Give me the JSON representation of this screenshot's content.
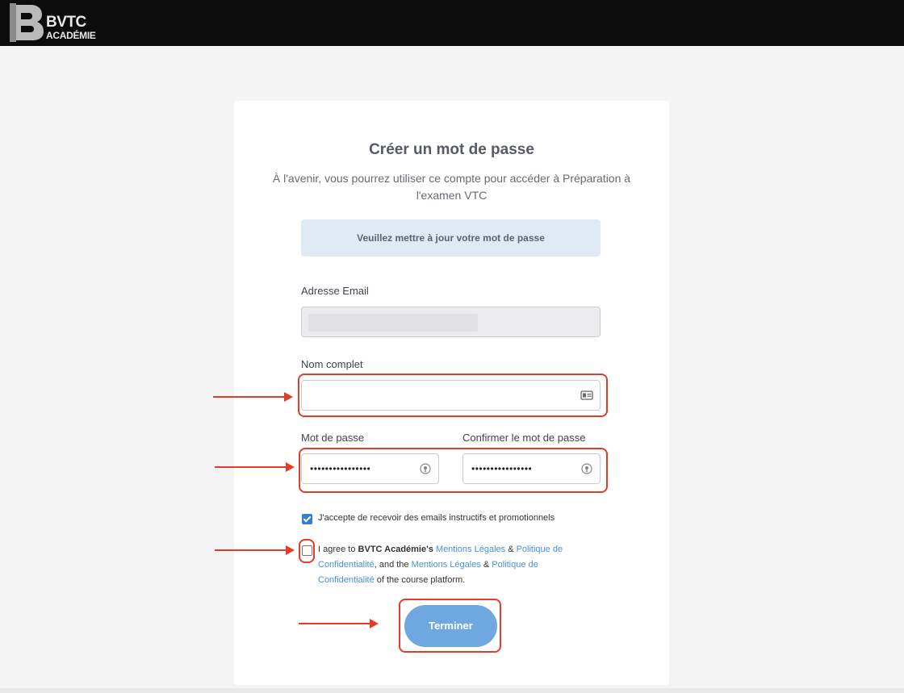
{
  "header": {
    "brand_line1": "BVTC",
    "brand_line2": "ACADÉMIE",
    "logo_icon": "bvtc-b-logo-icon"
  },
  "card": {
    "title": "Créer un mot de passe",
    "subtitle": "À l'avenir, vous pourrez utiliser ce compte pour accéder à Préparation à l'examen VTC",
    "notice": "Veuillez mettre à jour votre mot de passe"
  },
  "form": {
    "email_label": "Adresse Email",
    "email_value": "",
    "fullname_label": "Nom complet",
    "fullname_value": "",
    "fullname_icon": "contact-card-icon",
    "password_label": "Mot de passe",
    "password_value": "••••••••••••••••",
    "confirm_label": "Confirmer le mot de passe",
    "confirm_value": "••••••••••••••••",
    "password_icon": "password-reveal-icon",
    "marketing_consent": {
      "checked": true,
      "text": "J'accepte de recevoir des emails instructifs et promotionnels"
    },
    "terms": {
      "checked": false,
      "prefix": "I agree to ",
      "brand": "BVTC Académie's",
      "link1": "Mentions Légales",
      "amp1": " & ",
      "link2": "Politique de Confidentialité",
      "middle": ", and the ",
      "link3": "Mentions Légales",
      "amp2": " & ",
      "link4": "Politique de Confidentialité",
      "suffix": " of the course platform."
    },
    "submit_label": "Terminer"
  },
  "colors": {
    "header_bg": "#0c0c0c",
    "notice_bg": "#dfeaf5",
    "button_bg": "#6fa8e0",
    "link": "#4a90d9",
    "checkbox": "#2f7fd6",
    "annotation": "#e03d2a"
  }
}
